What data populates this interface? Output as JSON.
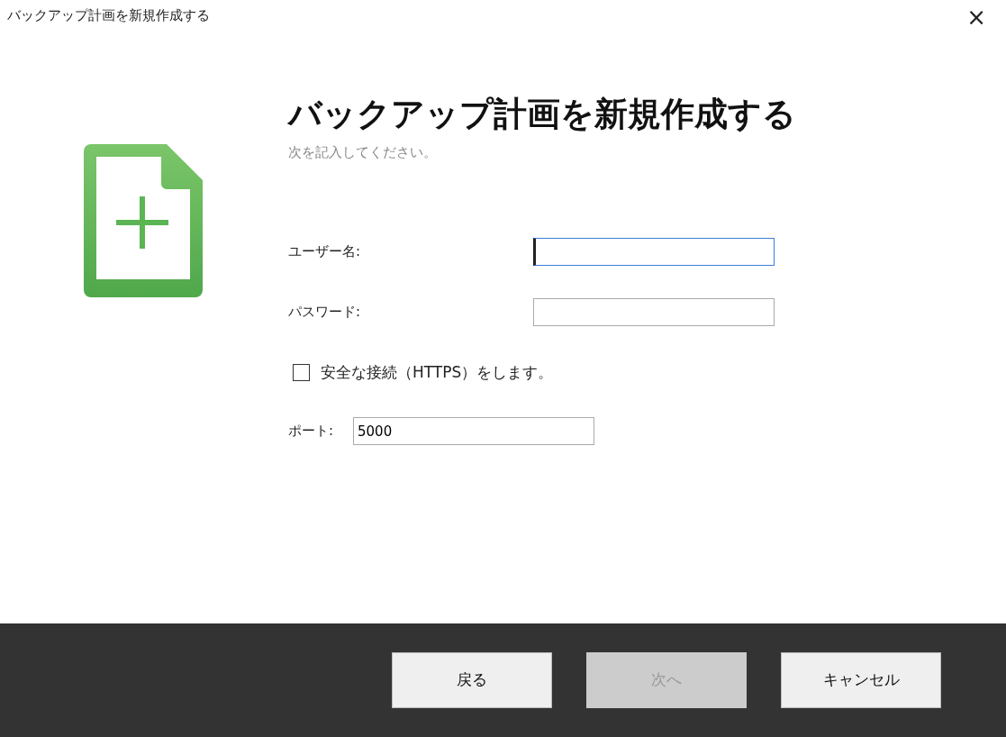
{
  "window": {
    "title": "バックアップ計画を新規作成する",
    "close": "×"
  },
  "header": {
    "title": "バックアップ計画を新規作成する",
    "subtitle": "次を記入してください。"
  },
  "fields": [
    {
      "label": "ユーザー名:",
      "focused": true
    },
    {
      "label": "パスワード:",
      "focused": false
    }
  ],
  "secure": {
    "label": "安全な接続（HTTPS）をします。",
    "checked": false
  },
  "port": {
    "label": "ポート:",
    "value": "5000"
  },
  "buttons": [
    {
      "label": "戻る",
      "disabled": false
    },
    {
      "label": "次へ",
      "disabled": true
    },
    {
      "label": "キャンセル",
      "disabled": false
    }
  ]
}
